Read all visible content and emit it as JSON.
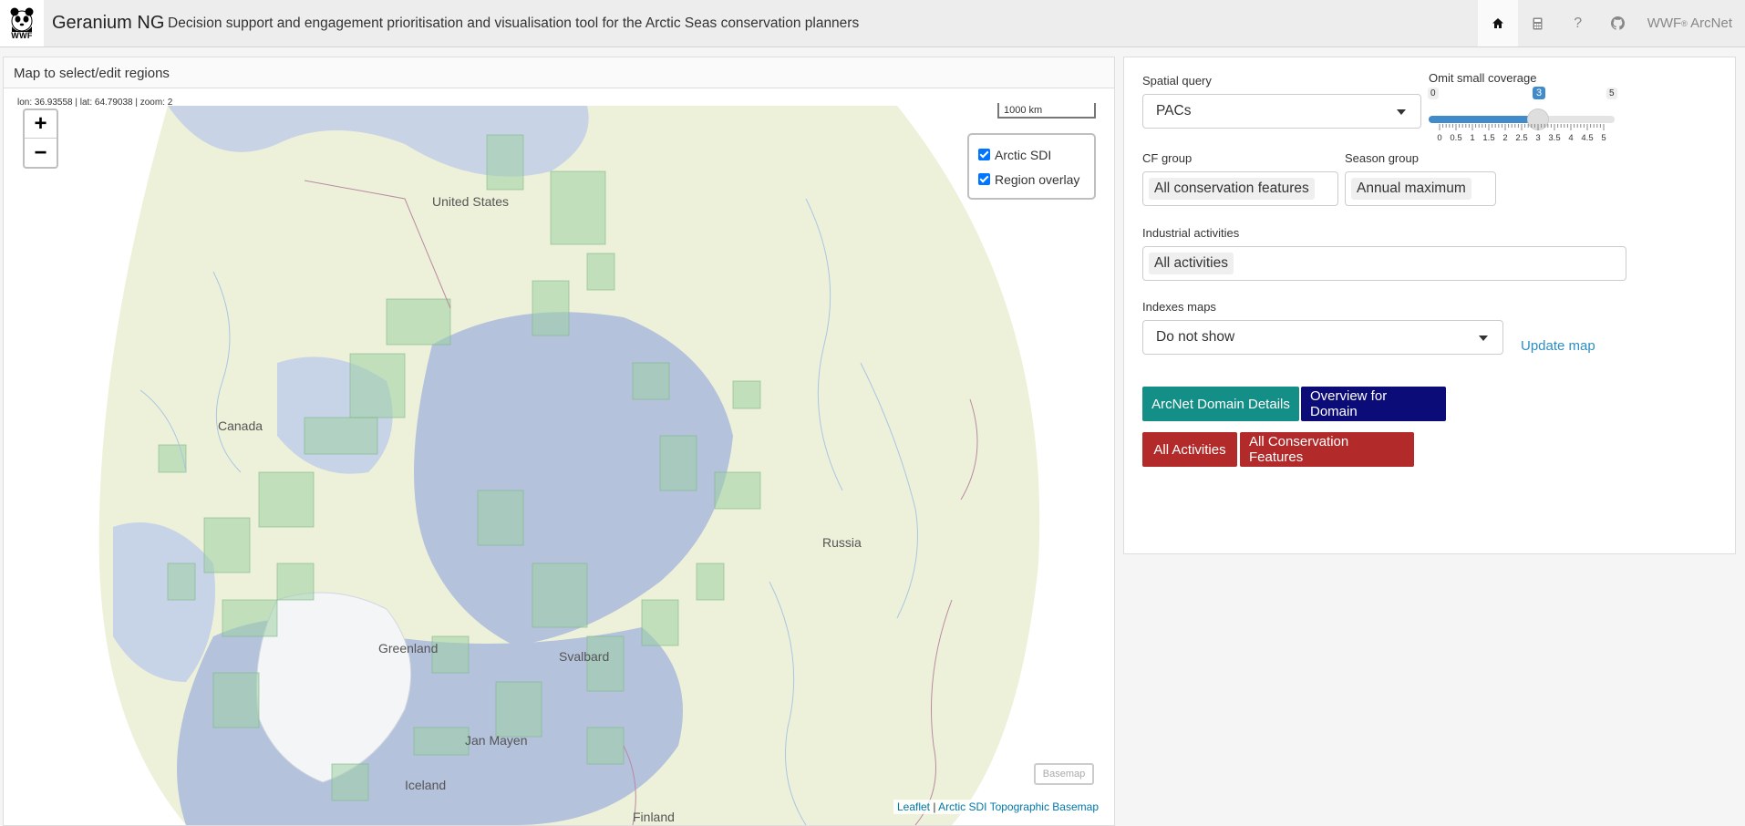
{
  "app": {
    "logo_text": "WWF",
    "title": "Geranium NG",
    "subtitle": "Decision support and engagement prioritisation and visualisation tool for the Arctic Seas conservation planners"
  },
  "nav": {
    "items": [
      {
        "name": "home-icon",
        "glyph": "⌂",
        "active": true
      },
      {
        "name": "calculator-icon",
        "glyph": "▦",
        "active": false
      },
      {
        "name": "help-icon",
        "glyph": "?",
        "active": false
      },
      {
        "name": "github-icon",
        "glyph": "◉",
        "active": false
      }
    ],
    "brand_prefix": "WWF",
    "brand_sup": "®",
    "brand_suffix": " ArcNet"
  },
  "map": {
    "header": "Map to select/edit regions",
    "coords": "lon: 36.93558 | lat: 64.79038 | zoom: 2",
    "zoom_in": "+",
    "zoom_out": "−",
    "scale_label": "1000 km",
    "layers": [
      {
        "label": "Arctic SDI",
        "checked": true
      },
      {
        "label": "Region overlay",
        "checked": true
      }
    ],
    "basemap_button": "Basemap",
    "attribution_leaflet": "Leaflet",
    "attribution_sep": " | ",
    "attribution_basemap": "Arctic SDI Topographic Basemap",
    "place_labels": {
      "united_states": "United States",
      "canada": "Canada",
      "russia": "Russia",
      "greenland": "Greenland",
      "svalbard": "Svalbard",
      "jan_mayen": "Jan Mayen",
      "iceland": "Iceland",
      "finland": "Finland"
    },
    "colors": {
      "ocean": "#b7c5dd",
      "land": "#eef1d9",
      "overlay": "#9fd0a4",
      "ice": "#f4f5f7"
    }
  },
  "controls": {
    "spatial_query": {
      "label": "Spatial query",
      "value": "PACs"
    },
    "omit_small_coverage": {
      "label": "Omit small coverage",
      "min": 0,
      "max": 5,
      "value": 3,
      "min_label": "0",
      "max_label": "5",
      "value_label": "3",
      "tick_labels": [
        "0",
        "0.5",
        "1",
        "1.5",
        "2",
        "2.5",
        "3",
        "3.5",
        "4",
        "4.5",
        "5"
      ]
    },
    "cf_group": {
      "label": "CF group",
      "value": "All conservation features"
    },
    "season_group": {
      "label": "Season group",
      "value": "Annual maximum"
    },
    "industrial_activities": {
      "label": "Industrial activities",
      "value": "All activities"
    },
    "indexes_maps": {
      "label": "Indexes maps",
      "value": "Do not show"
    },
    "update_map": "Update map",
    "buttons": {
      "arcnet_domain_details": "ArcNet Domain Details",
      "overview_for_domain": "Overview for Domain",
      "all_activities": "All Activities",
      "all_conservation_features": "All Conservation Features"
    },
    "colors": {
      "teal": "#148f87",
      "navy": "#0c0c78",
      "red": "#b22a2a",
      "slider": "#428bca"
    }
  }
}
